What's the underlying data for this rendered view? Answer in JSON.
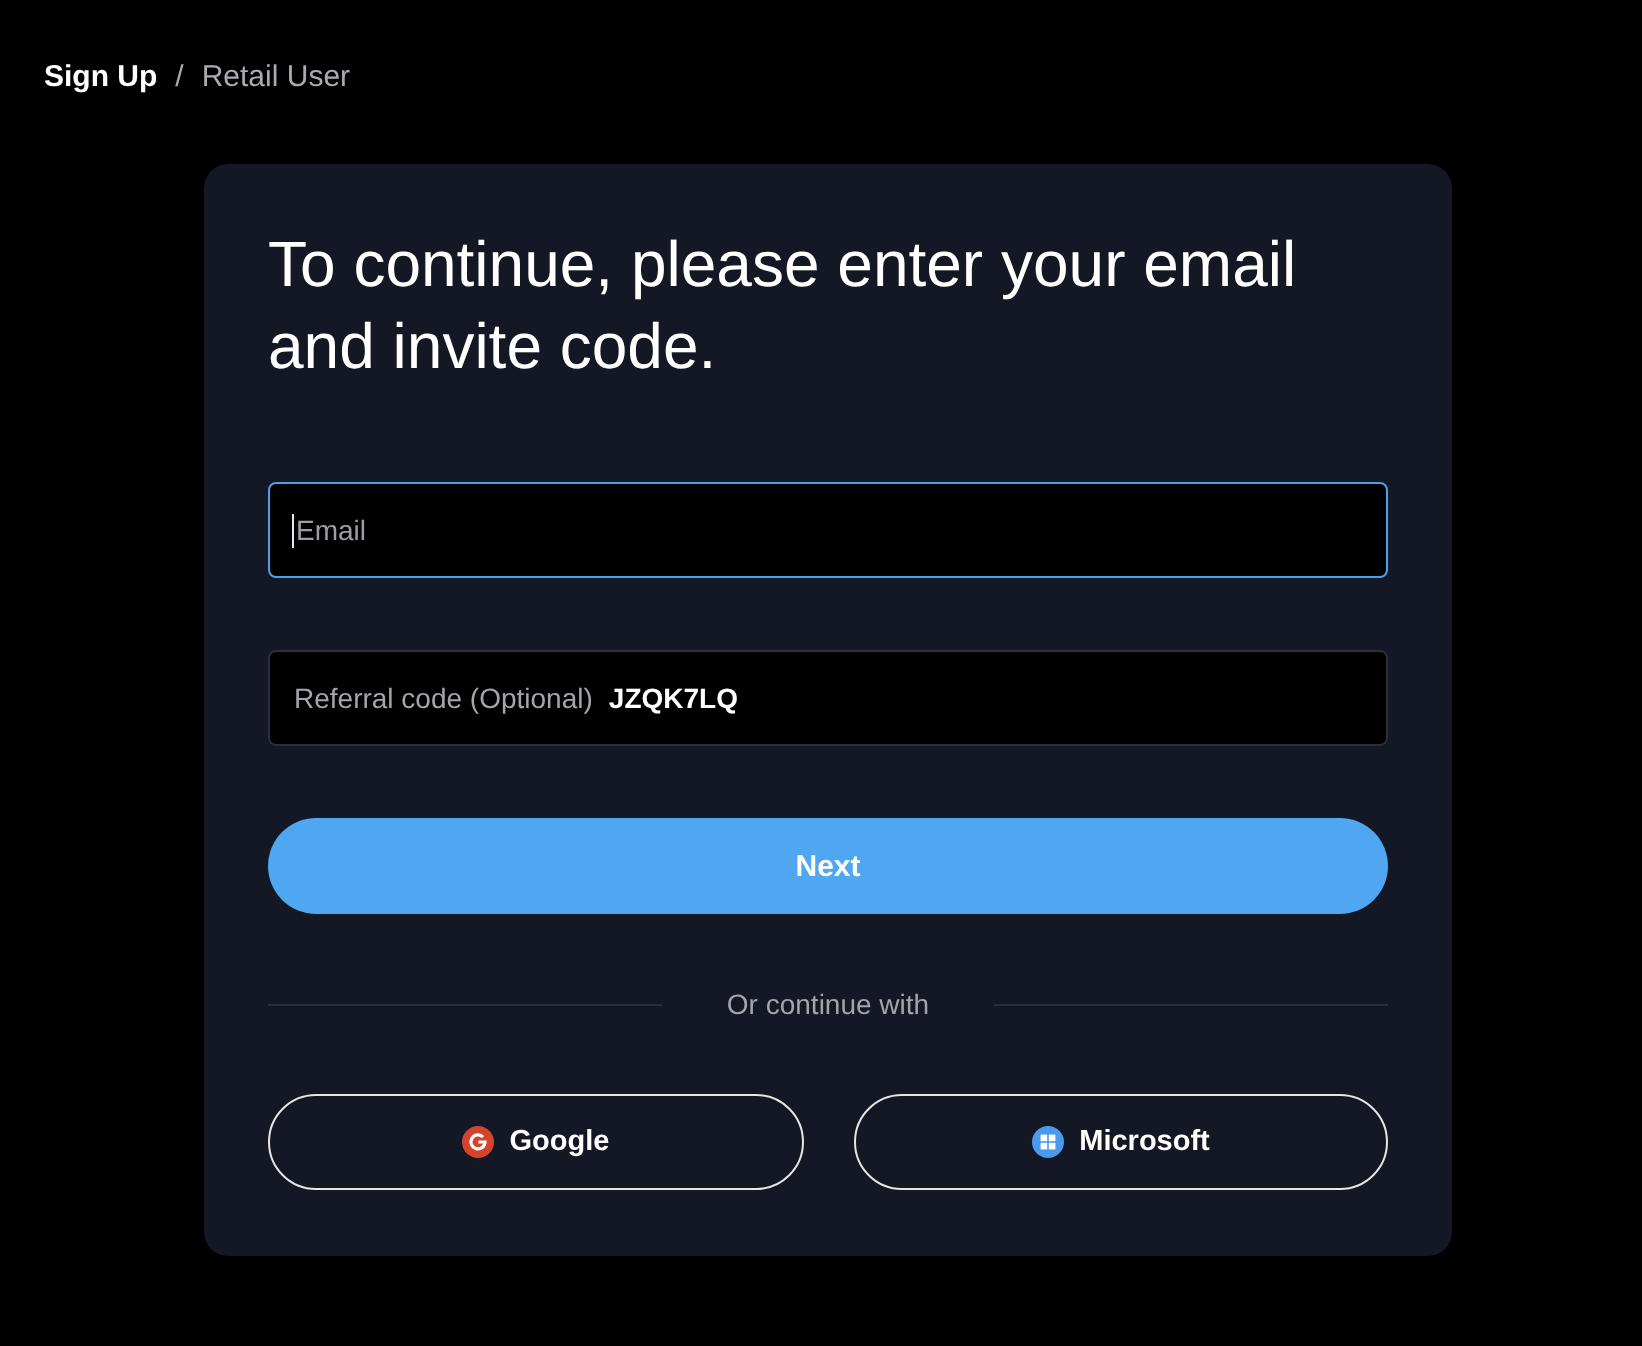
{
  "breadcrumb": {
    "items": [
      {
        "label": "Sign Up",
        "kind": "parent"
      },
      {
        "label": "Retail User",
        "kind": "current"
      }
    ],
    "separator": "/"
  },
  "title": "To continue, please enter your email and invite code.",
  "fields": [
    {
      "kind": "input",
      "placeholder": "Email",
      "focused": true
    },
    {
      "kind": "prefilled",
      "label": "Referral code (Optional)",
      "value": "JZQK7LQ",
      "focused": false
    }
  ],
  "next_button": {
    "label": "Next"
  },
  "divider": {
    "label": "Or continue with"
  },
  "social_buttons": [
    {
      "kind": "google",
      "label": "Google"
    },
    {
      "kind": "microsoft",
      "label": "Microsoft"
    }
  ]
}
